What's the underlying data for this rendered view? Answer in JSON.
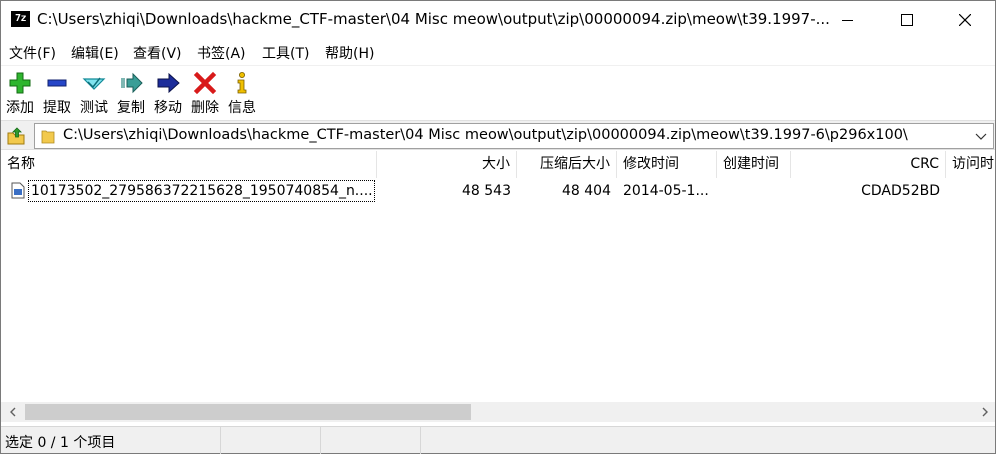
{
  "window": {
    "app_icon_text": "7z",
    "title": "C:\\Users\\zhiqi\\Downloads\\hackme_CTF-master\\04 Misc meow\\output\\zip\\00000094.zip\\meow\\t39.1997-..."
  },
  "menu": [
    {
      "label": "文件(F)"
    },
    {
      "label": "编辑(E)"
    },
    {
      "label": "查看(V)"
    },
    {
      "label": "书签(A)"
    },
    {
      "label": "工具(T)"
    },
    {
      "label": "帮助(H)"
    }
  ],
  "toolbar": [
    {
      "label": "添加",
      "icon": "plus-icon",
      "color": "#1aa31a"
    },
    {
      "label": "提取",
      "icon": "minus-icon",
      "color": "#1f3fbf"
    },
    {
      "label": "测试",
      "icon": "check-icon",
      "color": "#1fb8c8"
    },
    {
      "label": "复制",
      "icon": "copy-arrow-icon",
      "color": "#2a8c86"
    },
    {
      "label": "移动",
      "icon": "move-arrow-icon",
      "color": "#1a2a8c"
    },
    {
      "label": "删除",
      "icon": "delete-x-icon",
      "color": "#d01616"
    },
    {
      "label": "信息",
      "icon": "info-icon",
      "color": "#e8b800"
    }
  ],
  "address": {
    "path": "C:\\Users\\zhiqi\\Downloads\\hackme_CTF-master\\04 Misc meow\\output\\zip\\00000094.zip\\meow\\t39.1997-6\\p296x100\\"
  },
  "columns": [
    {
      "label": "名称"
    },
    {
      "label": "大小"
    },
    {
      "label": "压缩后大小"
    },
    {
      "label": "修改时间"
    },
    {
      "label": "创建时间"
    },
    {
      "label": "CRC"
    },
    {
      "label": "访问时"
    }
  ],
  "files": [
    {
      "name": "10173502_279586372215628_1950740854_n....",
      "size": "48 543",
      "packed_size": "48 404",
      "modified": "2014-05-1...",
      "created": "",
      "crc": "CDAD52BD",
      "accessed": ""
    }
  ],
  "scrollbar": {
    "thumb_fraction": 0.47
  },
  "status": {
    "selection": "选定 0 / 1 个项目"
  }
}
